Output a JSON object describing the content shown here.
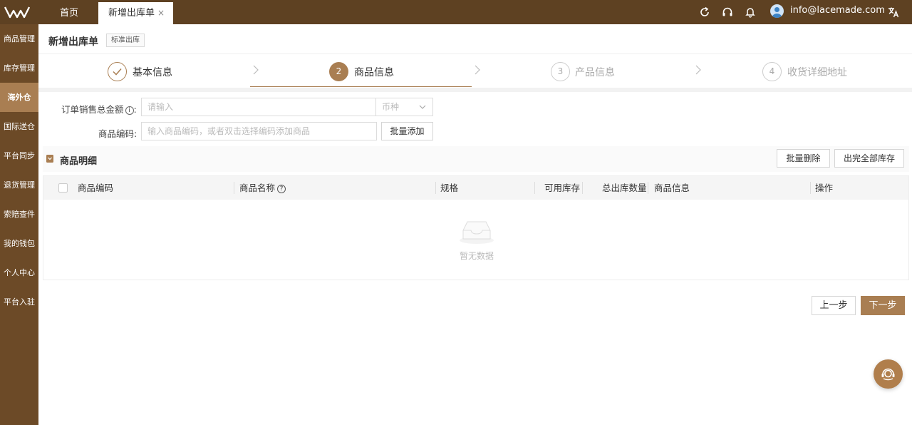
{
  "topbar": {
    "tabs": [
      {
        "label": "首页"
      },
      {
        "label": "新增出库单",
        "close": "×"
      }
    ],
    "user_email": "info@lacemade.com",
    "icons": [
      "refresh-icon",
      "headset-icon",
      "bell-icon",
      "avatar",
      "translate-icon"
    ]
  },
  "sidebar": {
    "items": [
      {
        "label": "商品管理"
      },
      {
        "label": "库存管理"
      },
      {
        "label": "海外仓"
      },
      {
        "label": "国际送仓"
      },
      {
        "label": "平台同步"
      },
      {
        "label": "退货管理"
      },
      {
        "label": "索赔查件"
      },
      {
        "label": "我的钱包"
      },
      {
        "label": "个人中心"
      },
      {
        "label": "平台入驻"
      }
    ],
    "active_index": 2
  },
  "page": {
    "title": "新增出库单",
    "tag": "标准出库"
  },
  "steps": [
    {
      "num": "✓",
      "label": "基本信息",
      "state": "done"
    },
    {
      "num": "2",
      "label": "商品信息",
      "state": "current"
    },
    {
      "num": "3",
      "label": "产品信息",
      "state": "wait"
    },
    {
      "num": "4",
      "label": "收货详细地址",
      "state": "wait"
    }
  ],
  "form": {
    "total_amount_label": "订单销售总金额",
    "info_icon": "i",
    "colon": ":",
    "total_amount_placeholder": "请输入",
    "currency_placeholder": "币种",
    "sku_label": "商品编码:",
    "sku_placeholder": "输入商品编码，或者双击选择编码添加商品",
    "bulk_add": "批量添加"
  },
  "detail": {
    "title": "商品明细",
    "bulk_delete": "批量删除",
    "all_out": "出完全部库存"
  },
  "table": {
    "headers": {
      "sku": "商品编码",
      "name": "商品名称",
      "name_help": "?",
      "spec": "规格",
      "available": "可用库存",
      "total_qty": "总出库数量",
      "info": "商品信息",
      "actions": "操作"
    },
    "empty_text": "暂无数据"
  },
  "footer": {
    "prev": "上一步",
    "next": "下一步"
  },
  "colors": {
    "brand_dark": "#5e4122",
    "sidebar": "#6c4a27",
    "accent": "#a97e52"
  }
}
